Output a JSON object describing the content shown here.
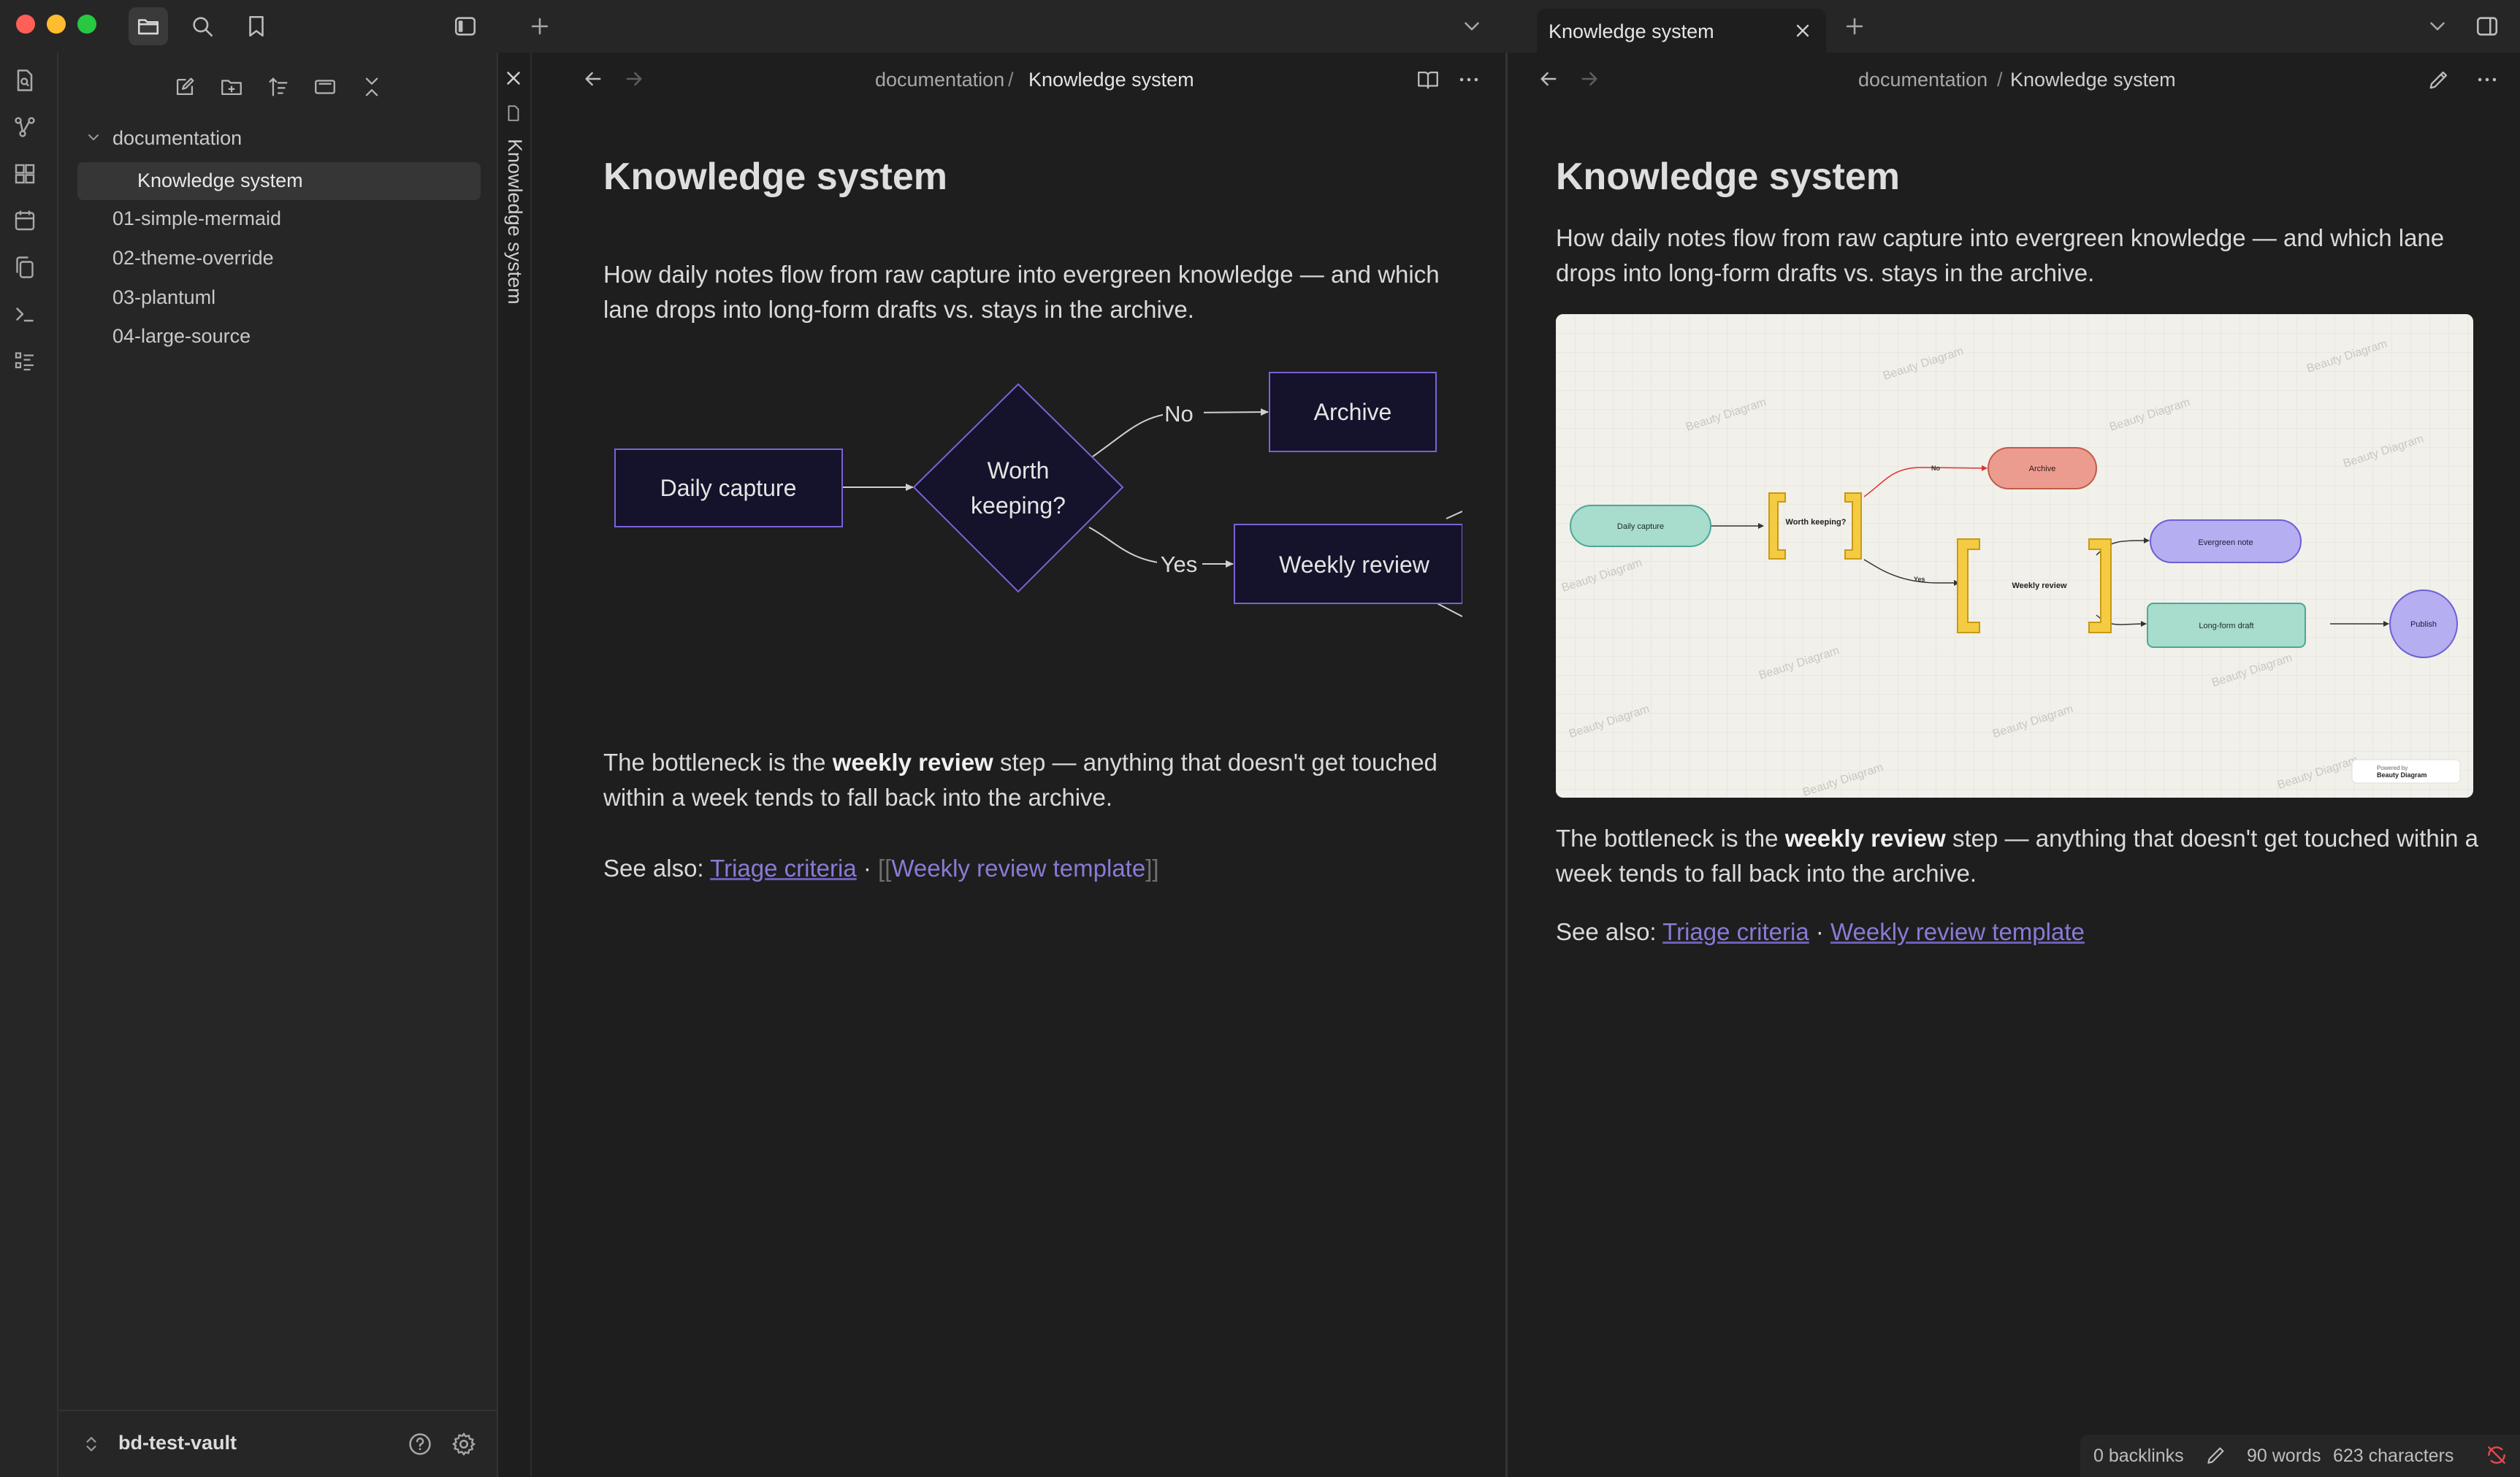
{
  "window": {
    "title": "Knowledge system"
  },
  "topbar": {
    "new_tab_symbol": "+",
    "right_tab_label": "Knowledge system",
    "right_tab_close": "✕",
    "right_new_tab_symbol": "+"
  },
  "sidebar": {
    "folder": "documentation",
    "items": [
      "Knowledge system",
      "01-simple-mermaid",
      "02-theme-override",
      "03-plantuml",
      "04-large-source"
    ],
    "vault_name": "bd-test-vault"
  },
  "left_pane": {
    "stacked_title": "Knowledge system",
    "breadcrumb_folder": "documentation",
    "breadcrumb_sep": "/",
    "breadcrumb_note": "Knowledge system",
    "title": "Knowledge system",
    "intro_line1": "How daily notes flow from raw capture into evergreen knowledge — and which",
    "intro_line2": "lane drops into long-form drafts vs. stays in the archive.",
    "bottleneck_pre": "The bottleneck is the ",
    "bottleneck_bold": "weekly review",
    "bottleneck_post1": " step — anything that doesn't get touched",
    "bottleneck_line2": "within a week tends to fall back into the archive.",
    "see_also_label": "See also: ",
    "see_also_link1": "Triage criteria",
    "see_also_sep": " · ",
    "see_also_open": "[[",
    "see_also_link2": "Weekly review template",
    "see_also_close": "]]",
    "diagram": {
      "daily_capture": "Daily capture",
      "decision_line1": "Worth",
      "decision_line2": "keeping?",
      "no_label": "No",
      "yes_label": "Yes",
      "archive": "Archive",
      "weekly_review": "Weekly review"
    }
  },
  "right_pane": {
    "breadcrumb_folder": "documentation",
    "breadcrumb_sep": "/",
    "breadcrumb_note": "Knowledge system",
    "title": "Knowledge system",
    "intro_line1": "How daily notes flow from raw capture into evergreen knowledge — and which lane",
    "intro_line2": "drops into long-form drafts vs. stays in the archive.",
    "bottleneck_pre": "The bottleneck is the ",
    "bottleneck_bold": "weekly review",
    "bottleneck_post1": " step — anything that doesn't get touched within a",
    "bottleneck_line2": "week tends to fall back into the archive.",
    "see_also_label": "See also: ",
    "see_also_link1": "Triage criteria",
    "see_also_sep": " · ",
    "see_also_link2": "Weekly review template",
    "diagram": {
      "daily_capture": "Daily capture",
      "decision": "Worth keeping?",
      "no_label": "No",
      "yes_label": "Yes",
      "archive": "Archive",
      "weekly_review": "Weekly review",
      "evergreen_note": "Evergreen note",
      "long_form_draft": "Long-form draft",
      "publish": "Publish",
      "watermark": "Beauty Diagram",
      "badge_line1": "Powered by",
      "badge_line2": "Beauty Diagram"
    }
  },
  "statusbar": {
    "backlinks": "0 backlinks",
    "words": "90 words",
    "characters": "623 characters"
  },
  "colors": {
    "accent": "#8a7ad6",
    "node_fill": "#14132b",
    "node_stroke": "#7b62d8"
  }
}
